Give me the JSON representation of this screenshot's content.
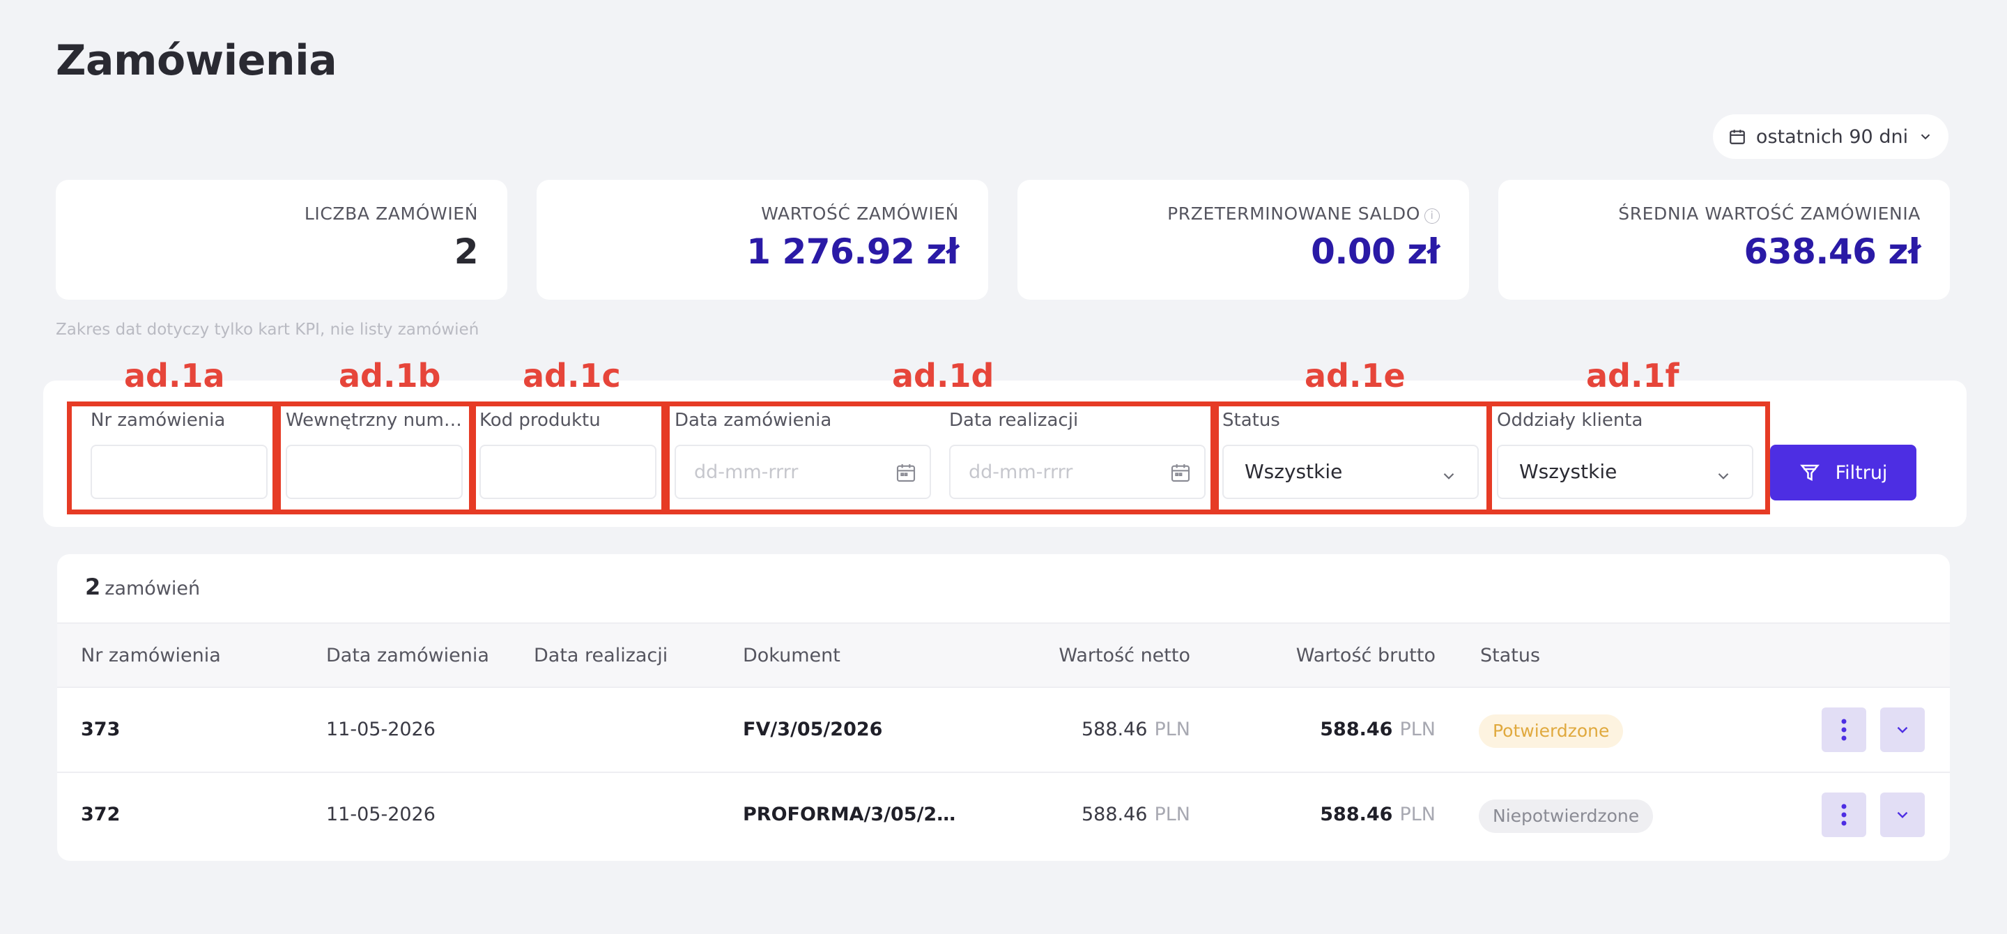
{
  "page": {
    "title": "Zamówienia"
  },
  "date_range": {
    "label": "ostatnich 90 dni"
  },
  "kpis": [
    {
      "label": "LICZBA ZAMÓWIEŃ",
      "value": "2"
    },
    {
      "label": "WARTOŚĆ ZAMÓWIEŃ",
      "value": "1 276.92 zł"
    },
    {
      "label": "PRZETERMINOWANE SALDO",
      "value": "0.00 zł",
      "info_icon": "i"
    },
    {
      "label": "ŚREDNIA WARTOŚĆ ZAMÓWIENIA",
      "value": "638.46 zł"
    }
  ],
  "kpi_note": "Zakres dat dotyczy tylko kart KPI, nie listy zamówień",
  "filters": {
    "order_number": {
      "label": "Nr zamówienia",
      "value": ""
    },
    "internal_number": {
      "label": "Wewnętrzny num…",
      "value": ""
    },
    "product_code": {
      "label": "Kod produktu",
      "value": ""
    },
    "order_date": {
      "label": "Data zamówienia",
      "placeholder": "dd-mm-rrrr"
    },
    "realization_date": {
      "label": "Data realizacji",
      "placeholder": "dd-mm-rrrr"
    },
    "status": {
      "label": "Status",
      "value": "Wszystkie"
    },
    "branches": {
      "label": "Oddziały klienta",
      "value": "Wszystkie"
    },
    "filter_button": "Filtruj"
  },
  "annotations": [
    "ad.1a",
    "ad.1b",
    "ad.1c",
    "ad.1d",
    "ad.1e",
    "ad.1f"
  ],
  "orders": {
    "count": "2",
    "count_label": "zamówień",
    "columns": [
      "Nr zamówienia",
      "Data zamówienia",
      "Data realizacji",
      "Dokument",
      "Wartość netto",
      "Wartość brutto",
      "Status"
    ],
    "rows": [
      {
        "number": "373",
        "order_date": "11-05-2026",
        "realization_date": "",
        "document": "FV/3/05/2026",
        "net": "588.46",
        "gross": "588.46",
        "currency": "PLN",
        "status": "Potwierdzone"
      },
      {
        "number": "372",
        "order_date": "11-05-2026",
        "realization_date": "",
        "document": "PROFORMA/3/05/2…",
        "net": "588.46",
        "gross": "588.46",
        "currency": "PLN",
        "status": "Niepotwierdzone"
      }
    ]
  },
  "colors": {
    "accent": "#4d2ee3",
    "kpi_value": "#2a1aa6",
    "annotation": "#e63b25",
    "confirmed": "#e0a93e"
  }
}
